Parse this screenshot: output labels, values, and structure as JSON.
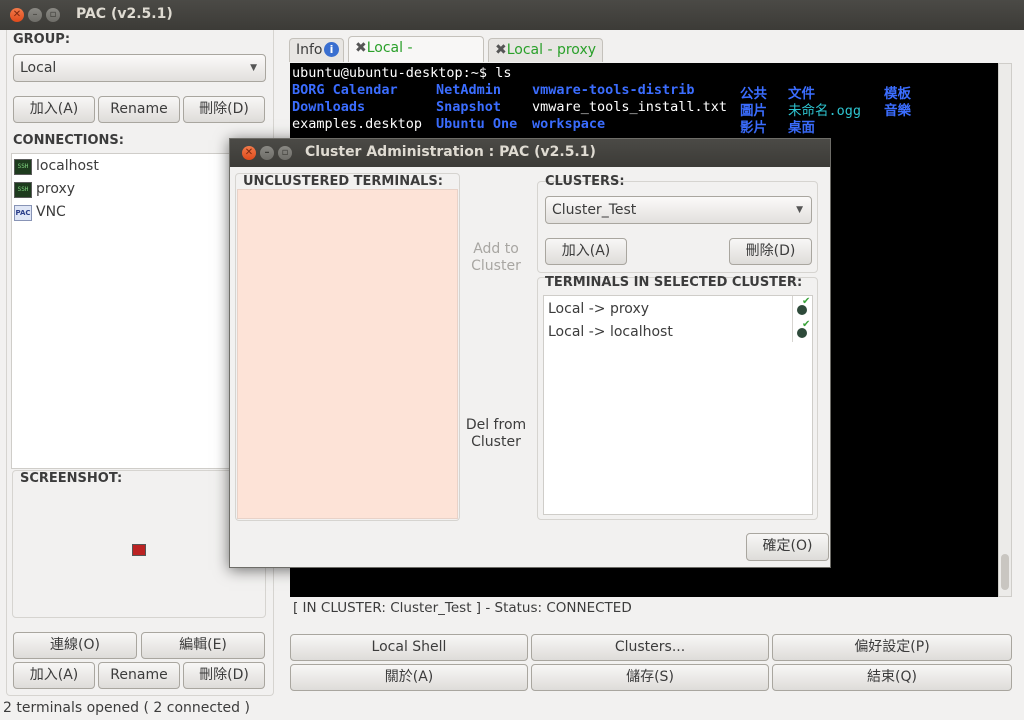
{
  "window": {
    "title": "PAC (v2.5.1)"
  },
  "left": {
    "group_label": "GROUP:",
    "group_value": "Local",
    "group_buttons": {
      "add": "加入(A)",
      "rename": "Rename",
      "delete": "刪除(D)"
    },
    "connections_label": "CONNECTIONS:",
    "connections": [
      {
        "name": "localhost",
        "icon": "ssh-icon",
        "icon_text": "SSH"
      },
      {
        "name": "proxy",
        "icon": "ssh-icon",
        "icon_text": "SSH"
      },
      {
        "name": "VNC",
        "icon": "vnc-icon",
        "icon_text": "PAC"
      }
    ],
    "screenshot_label": "SCREENSHOT:",
    "buttons_row1": {
      "connect": "連線(O)",
      "edit": "編輯(E)"
    },
    "buttons_row2": {
      "add": "加入(A)",
      "rename": "Rename",
      "delete": "刪除(D)"
    }
  },
  "tabs": [
    {
      "label": "Info",
      "icon": "info-icon"
    },
    {
      "label": "Local - localhost",
      "icon": "close-icon"
    },
    {
      "label": "Local - proxy",
      "icon": "close-icon"
    }
  ],
  "terminal": {
    "prompt": "ubuntu@ubuntu-desktop:~$ ls",
    "row1": [
      "BORG Calendar",
      "NetAdmin",
      "vmware-tools-distrib",
      "公共",
      "文件",
      "模板"
    ],
    "row2": [
      "Downloads",
      "Snapshot",
      "vmware_tools_install.txt",
      "圖片",
      "未命名.ogg",
      "音樂"
    ],
    "row3": [
      "examples.desktop",
      "Ubuntu One",
      "workspace",
      "影片",
      "桌面"
    ]
  },
  "status_line": "[ IN CLUSTER: Cluster_Test ] - Status: CONNECTED",
  "bottom_buttons": {
    "local_shell": "Local Shell",
    "clusters": "Clusters...",
    "preferences": "偏好設定(P)",
    "about": "關於(A)",
    "save": "儲存(S)",
    "quit": "結束(Q)"
  },
  "statusbar": "2 terminals opened ( 2 connected )",
  "dialog": {
    "title": "Cluster Administration : PAC (v2.5.1)",
    "unclustered_label": "UNCLUSTERED TERMINALS:",
    "add_to_cluster": "Add to\nCluster",
    "del_from_cluster": "Del from\nCluster",
    "clusters_label": "CLUSTERS:",
    "cluster_value": "Cluster_Test",
    "add_button": "加入(A)",
    "delete_button": "刪除(D)",
    "terminals_label": "TERMINALS IN SELECTED CLUSTER:",
    "terminals": [
      "Local -> proxy",
      "Local -> localhost"
    ],
    "ok_button": "確定(O)"
  },
  "colors": {
    "accent_tab_text": "#2aa02a",
    "term_blue": "#3b6dff",
    "term_cyan": "#2ec4d0",
    "unclustered_bg": "#fde3d7"
  }
}
